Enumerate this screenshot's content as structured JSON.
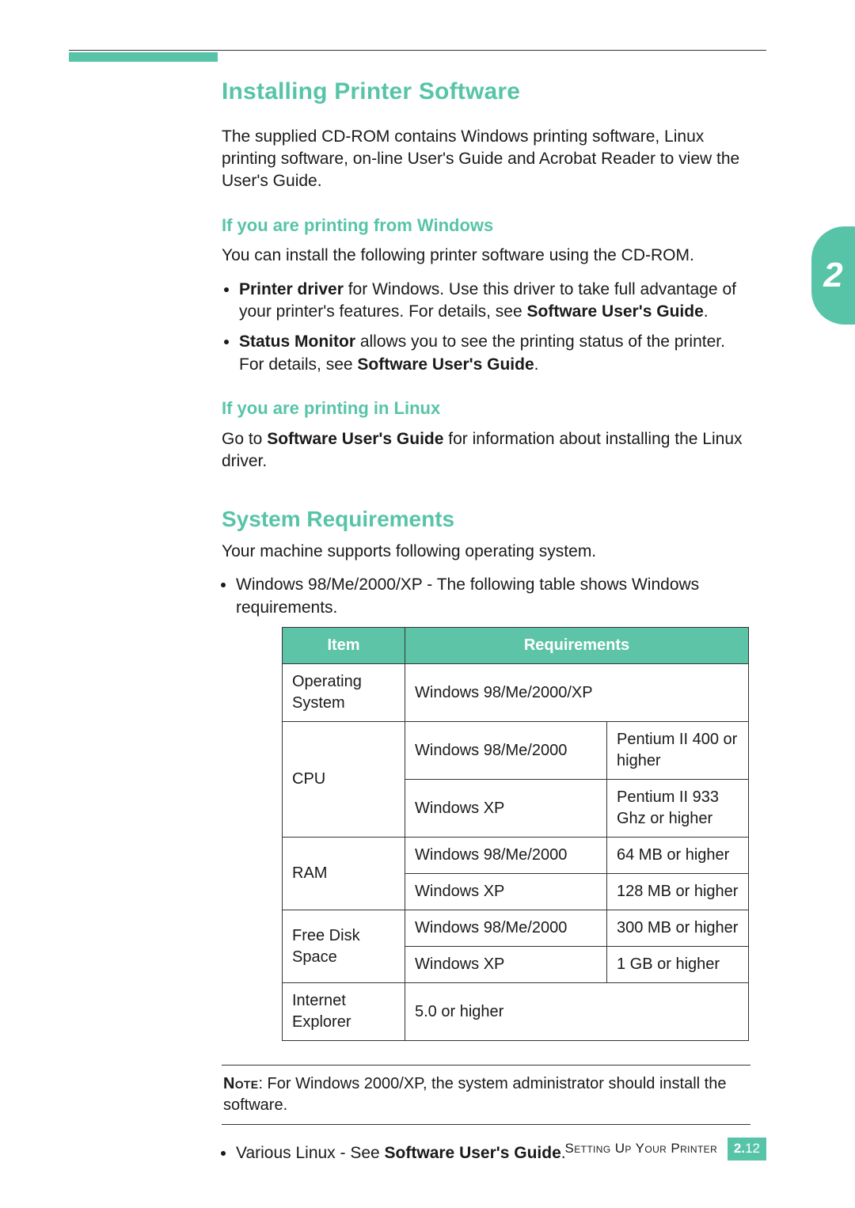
{
  "chapter_number": "2",
  "section_title": "Installing Printer Software",
  "intro_paragraph": "The supplied CD-ROM contains Windows printing software, Linux printing software, on-line User's Guide and Acrobat Reader to view the User's Guide.",
  "windows": {
    "heading": "If you are printing from Windows",
    "intro": "You can install the following printer software using the CD-ROM.",
    "bullets": {
      "b1_strong": "Printer driver",
      "b1_rest_a": " for Windows. Use this driver to take full advantage of your printer's features. For details, see ",
      "b1_strong2": "Software User's Guide",
      "b1_end": ".",
      "b2_strong": "Status Monitor",
      "b2_rest_a": " allows you to see the printing status of the printer. For details, see ",
      "b2_strong2": "Software User's Guide",
      "b2_end": "."
    }
  },
  "linux": {
    "heading": "If you are printing in Linux",
    "text_a": "Go to ",
    "text_strong": "Software User's Guide",
    "text_b": " for information about installing the Linux driver."
  },
  "sysreq": {
    "heading": "System Requirements",
    "intro": "Your machine supports following operating system.",
    "bullet": "Windows 98/Me/2000/XP - The following table shows Windows requirements.",
    "table": {
      "head_item": "Item",
      "head_req": "Requirements",
      "rows": {
        "os_item": "Operating System",
        "os_req": "Windows 98/Me/2000/XP",
        "cpu_item": "CPU",
        "cpu_r1a": "Windows 98/Me/2000",
        "cpu_r1b": "Pentium II 400 or higher",
        "cpu_r2a": "Windows XP",
        "cpu_r2b": "Pentium II 933 Ghz or higher",
        "ram_item": "RAM",
        "ram_r1a": "Windows 98/Me/2000",
        "ram_r1b": "64 MB or higher",
        "ram_r2a": "Windows XP",
        "ram_r2b": "128 MB or higher",
        "disk_item": "Free Disk Space",
        "disk_r1a": "Windows 98/Me/2000",
        "disk_r1b": "300 MB or higher",
        "disk_r2a": "Windows XP",
        "disk_r2b": "1 GB or higher",
        "ie_item": "Internet Explorer",
        "ie_req": "5.0 or higher"
      }
    },
    "note_label": "Note",
    "note_text": ": For Windows 2000/XP, the system administrator should install the software.",
    "bullet2_a": "Various Linux - See ",
    "bullet2_strong": "Software User's Guide",
    "bullet2_b": "."
  },
  "footer": {
    "label": "Setting Up Your Printer",
    "page_chapter": "2.",
    "page_num": "12"
  }
}
